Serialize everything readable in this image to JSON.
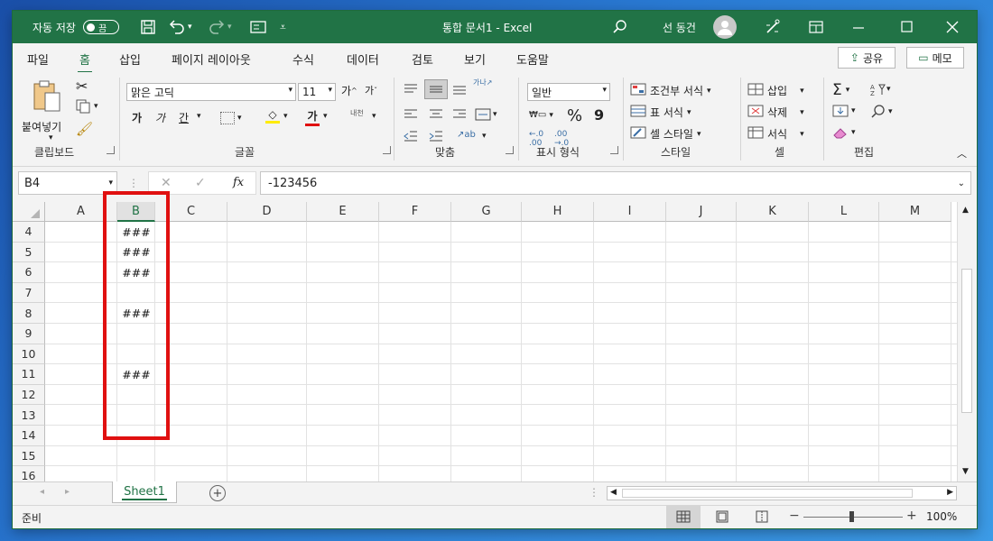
{
  "titlebar": {
    "autosave_label": "자동 저장",
    "autosave_state": "끔",
    "document_title": "통합 문서1 - Excel",
    "user_name": "선 동건"
  },
  "tabs": [
    "파일",
    "홈",
    "삽입",
    "페이지 레이아웃",
    "수식",
    "데이터",
    "검토",
    "보기",
    "도움말"
  ],
  "active_tab": "홈",
  "share_label": "공유",
  "memo_label": "메모",
  "ribbon": {
    "clipboard": {
      "paste_label": "붙여넣기",
      "group": "클립보드"
    },
    "font": {
      "font_name": "맑은 고딕",
      "font_size": "11",
      "grow_label": "가ˆ",
      "shrink_label": "가ˇ",
      "bold": "가",
      "italic": "가",
      "underline": "간",
      "font_color_glyph": "가",
      "phonetic": "내천",
      "group": "글꼴"
    },
    "alignment": {
      "group": "맞춤"
    },
    "number": {
      "format": "일반",
      "percent": "%",
      "comma": "9",
      "group": "표시 형식"
    },
    "styles": {
      "conditional": "조건부 서식",
      "table": "표 서식",
      "cell_styles": "셀 스타일",
      "group": "스타일"
    },
    "cells": {
      "insert": "삽입",
      "delete": "삭제",
      "format": "서식",
      "group": "셀"
    },
    "editing": {
      "group": "편집"
    }
  },
  "formula_bar": {
    "name_box": "B4",
    "fx": "fx",
    "value": "-123456"
  },
  "columns": [
    "A",
    "B",
    "C",
    "D",
    "E",
    "F",
    "G",
    "H",
    "I",
    "J",
    "K",
    "L",
    "M"
  ],
  "rows": [
    "4",
    "5",
    "6",
    "7",
    "8",
    "9",
    "10",
    "11",
    "12",
    "13",
    "14",
    "15",
    "16"
  ],
  "cells": {
    "B4": "###",
    "B5": "###",
    "B6": "###",
    "B8": "###",
    "B11": "###"
  },
  "sheet_tab": "Sheet1",
  "status": {
    "mode": "준비",
    "zoom": "100%"
  },
  "colors": {
    "excel_green": "#217346",
    "highlight": "#e01010"
  }
}
